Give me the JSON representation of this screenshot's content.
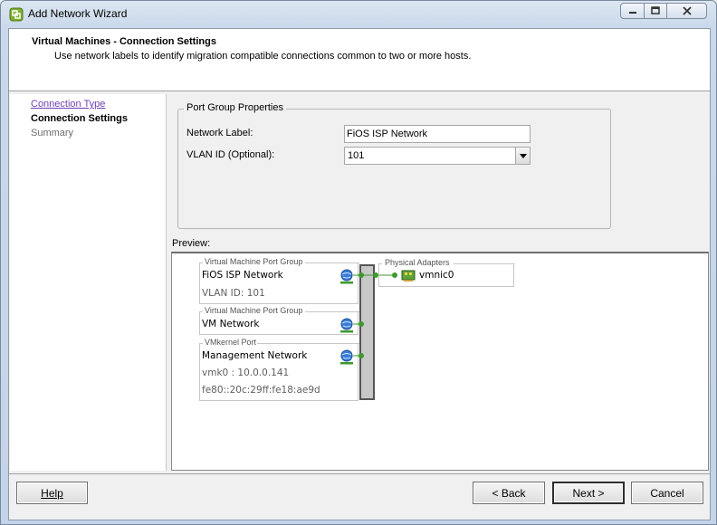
{
  "window": {
    "title": "Add Network Wizard"
  },
  "header": {
    "title": "Virtual Machines - Connection Settings",
    "description": "Use network labels to identify migration compatible connections common to two or more hosts."
  },
  "steps": [
    {
      "label": "Connection Type",
      "state": "visited"
    },
    {
      "label": "Connection Settings",
      "state": "current"
    },
    {
      "label": "Summary",
      "state": "pending"
    }
  ],
  "port_group_properties": {
    "legend": "Port Group Properties",
    "network_label_caption": "Network Label:",
    "network_label_value": "FiOS ISP Network",
    "vlan_caption": "VLAN ID (Optional):",
    "vlan_value": "101"
  },
  "preview": {
    "label": "Preview:",
    "port_groups": [
      {
        "caption": "Virtual Machine Port Group",
        "name": "FiOS ISP Network",
        "details": [
          "VLAN ID: 101"
        ]
      },
      {
        "caption": "Virtual Machine Port Group",
        "name": "VM Network",
        "details": []
      },
      {
        "caption": "VMkernel Port",
        "name": "Management Network",
        "details": [
          "vmk0 : 10.0.0.141",
          "fe80::20c:29ff:fe18:ae9d"
        ]
      }
    ],
    "physical_adapters": {
      "caption": "Physical Adapters",
      "adapters": [
        "vmnic0"
      ]
    }
  },
  "buttons": {
    "help": "Help",
    "back": "< Back",
    "next": "Next >",
    "cancel": "Cancel"
  },
  "colors": {
    "connector_green": "#3c9a2c",
    "visited_step": "#6f3fb6"
  }
}
